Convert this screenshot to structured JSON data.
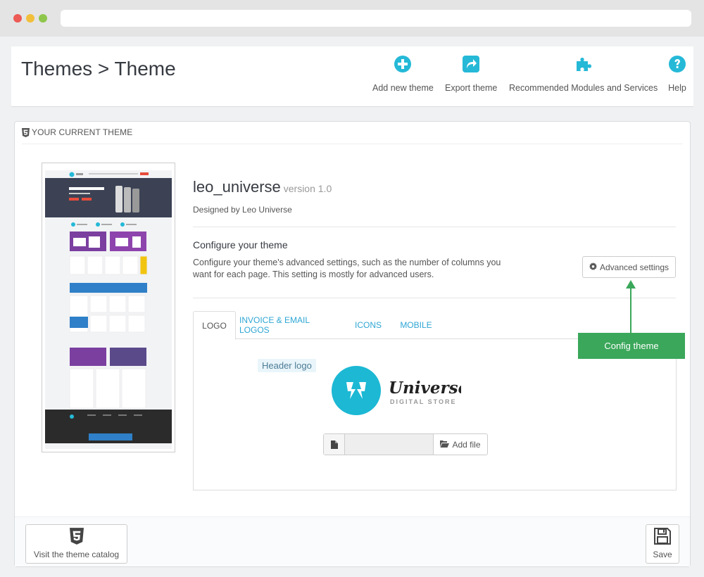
{
  "header": {
    "title": "Themes > Theme",
    "toolbar": [
      {
        "label": "Add new theme",
        "icon": "plus-circle-icon"
      },
      {
        "label": "Export theme",
        "icon": "share-icon"
      },
      {
        "label": "Recommended Modules and Services",
        "icon": "puzzle-icon"
      },
      {
        "label": "Help",
        "icon": "question-circle-icon"
      }
    ]
  },
  "panel": {
    "heading": "YOUR CURRENT THEME",
    "theme_name": "leo_universe",
    "theme_version": "version 1.0",
    "designer": "Designed by Leo Universe",
    "configure_title": "Configure your theme",
    "configure_desc": "Configure your theme's advanced settings, such as the number of columns you want for each page. This setting is mostly for advanced users.",
    "advanced_button": "Advanced settings",
    "tabs": [
      {
        "label": "LOGO",
        "active": true
      },
      {
        "label": "INVOICE & EMAIL LOGOS",
        "active": false
      },
      {
        "label": "ICONS",
        "active": false
      },
      {
        "label": "MOBILE",
        "active": false
      }
    ],
    "header_logo_label": "Header logo",
    "logo": {
      "name": "Universe",
      "tagline": "DIGITAL STORE"
    },
    "add_file": "Add file",
    "footer": {
      "catalog_button": "Visit the theme catalog",
      "save_button": "Save"
    }
  },
  "callout": "Config theme",
  "colors": {
    "accent": "#25b9d7",
    "callout": "#3aa75a",
    "link": "#2ea6d4"
  }
}
